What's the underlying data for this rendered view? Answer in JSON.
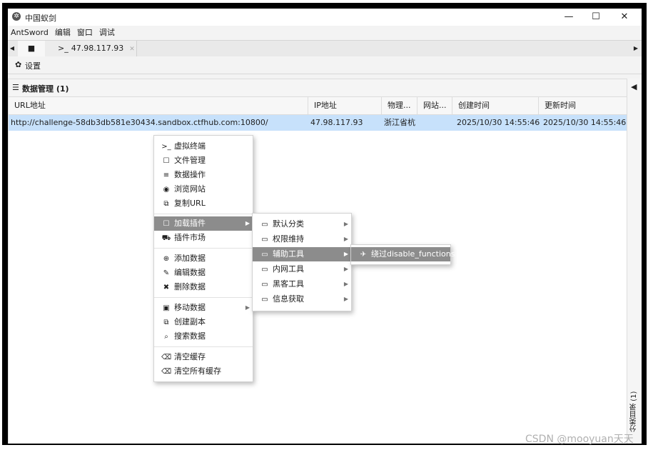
{
  "window": {
    "title": "中国蚁剑",
    "minimize": "—",
    "maximize": "☐",
    "close": "✕"
  },
  "menubar": [
    "AntSword",
    "编辑",
    "窗口",
    "调试"
  ],
  "tabs": {
    "left_arrow": "◀",
    "home_icon": "■",
    "host_icon": ">_",
    "host": "47.98.117.93",
    "close": "✕",
    "right_arrow": "▶"
  },
  "toolbar": {
    "settings_icon": "✿",
    "settings": "设置"
  },
  "panel": {
    "icon": "☰",
    "title": "数据管理 (1)"
  },
  "table": {
    "headers": [
      "URL地址",
      "IP地址",
      "物理...",
      "网站...",
      "创建时间",
      "更新时间"
    ],
    "rows": [
      {
        "url": "http://challenge-58db3db581e30434.sandbox.ctfhub.com:10800/",
        "ip": "47.98.117.93",
        "location": "浙江省杭",
        "site": "",
        "created": "2025/10/30 14:55:46",
        "updated": "2025/10/30 14:55:46"
      }
    ]
  },
  "side": {
    "collapse": "◀",
    "label": "分类目录 (1)"
  },
  "context_menu": {
    "items": [
      {
        "icon": ">_",
        "label": "虚拟终端"
      },
      {
        "icon": "☐",
        "label": "文件管理"
      },
      {
        "icon": "≡",
        "label": "数据操作"
      },
      {
        "icon": "◉",
        "label": "浏览网站"
      },
      {
        "icon": "⧉",
        "label": "复制URL"
      },
      {
        "icon": "☐",
        "label": "加载插件",
        "submenu": true
      },
      {
        "icon": "⛟",
        "label": "插件市场"
      },
      {
        "icon": "⊕",
        "label": "添加数据"
      },
      {
        "icon": "✎",
        "label": "编辑数据"
      },
      {
        "icon": "✖",
        "label": "删除数据"
      },
      {
        "icon": "▣",
        "label": "移动数据",
        "submenu": true
      },
      {
        "icon": "⧉",
        "label": "创建副本"
      },
      {
        "icon": "⌕",
        "label": "搜索数据"
      },
      {
        "icon": "⌫",
        "label": "清空缓存"
      },
      {
        "icon": "⌫",
        "label": "清空所有缓存"
      }
    ],
    "submenu_arrow": "▶"
  },
  "plugin_menu": {
    "items": [
      {
        "icon": "▭",
        "label": "默认分类"
      },
      {
        "icon": "▭",
        "label": "权限维持"
      },
      {
        "icon": "▭",
        "label": "辅助工具"
      },
      {
        "icon": "▭",
        "label": "内网工具"
      },
      {
        "icon": "▭",
        "label": "黑客工具"
      },
      {
        "icon": "▭",
        "label": "信息获取"
      }
    ]
  },
  "tool_menu": {
    "icon": "✈",
    "label": "绕过disable_functions"
  },
  "watermark": "CSDN @mooyuan天天"
}
